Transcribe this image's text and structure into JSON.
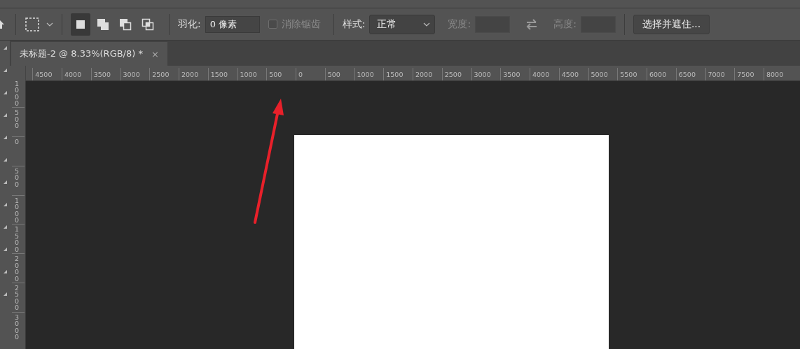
{
  "options_bar": {
    "selection_modes": [
      {
        "kind": "new",
        "selected": true
      },
      {
        "kind": "add",
        "selected": false
      },
      {
        "kind": "subtract",
        "selected": false
      },
      {
        "kind": "intersect",
        "selected": false
      }
    ],
    "feather": {
      "label": "羽化:",
      "value": "0 像素"
    },
    "anti_alias": {
      "label": "消除锯齿",
      "checked": false,
      "disabled": true
    },
    "style": {
      "label": "样式:",
      "value": "正常"
    },
    "width": {
      "label": "宽度:",
      "disabled": true
    },
    "height": {
      "label": "高度:",
      "disabled": true
    },
    "button": "选择并遮住..."
  },
  "tabs": [
    {
      "title": "未标题-2 @ 8.33%(RGB/8) *",
      "close": "×",
      "selected": true
    }
  ],
  "rulers": {
    "horizontal": [
      "4500",
      "4000",
      "3500",
      "3000",
      "2500",
      "2000",
      "1500",
      "1000",
      "500",
      "0",
      "500",
      "1000",
      "1500",
      "2000",
      "2500",
      "3000",
      "3500",
      "4000",
      "4500",
      "5000",
      "5500",
      "6000",
      "6500",
      "7000",
      "7500",
      "8000"
    ],
    "vertical": [
      "1000",
      "500",
      "0",
      "500",
      "1000",
      "1500",
      "2000",
      "2500",
      "3000"
    ]
  }
}
